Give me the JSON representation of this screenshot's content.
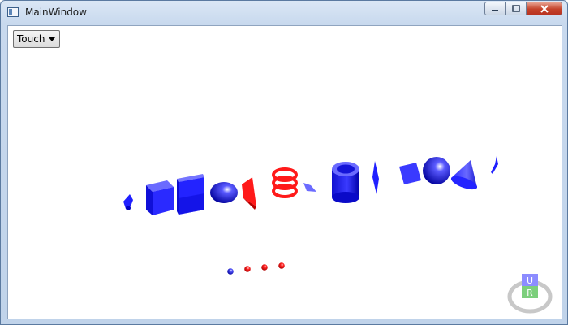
{
  "window": {
    "title": "MainWindow"
  },
  "toolbar": {
    "mode_value": "Touch"
  },
  "view_cube": {
    "top_face": "U",
    "front_face": "R"
  },
  "colors": {
    "blue": "#1f1fff",
    "red": "#ff1a1a",
    "cube_top": "#8c8cff",
    "cube_front": "#7ccf7c",
    "ring": "#c8c8c8"
  },
  "icons": {
    "minimize": "minimize-icon",
    "maximize": "maximize-icon",
    "close": "close-icon",
    "dropdown": "chevron-down-icon"
  }
}
